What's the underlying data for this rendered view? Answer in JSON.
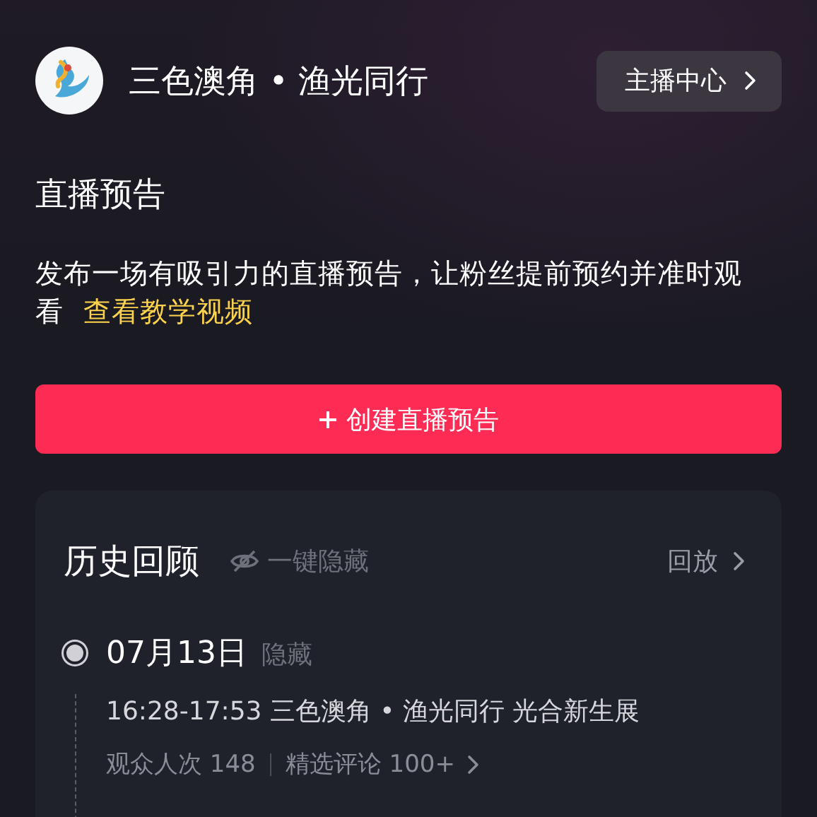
{
  "header": {
    "account_name": "三色澳角 • 渔光同行",
    "center_button": "主播中心"
  },
  "preview": {
    "title": "直播预告",
    "description": "发布一场有吸引力的直播预告，让粉丝提前预约并准时观看",
    "tutorial_link": "查看教学视频",
    "create_button": "创建直播预告"
  },
  "history": {
    "title": "历史回顾",
    "hide_all": "一键隐藏",
    "replay": "回放",
    "entries": [
      {
        "date": "07月13日",
        "hide": "隐藏",
        "session": "16:28-17:53 三色澳角 • 渔光同行 光合新生展",
        "viewers": "观众人次 148",
        "comments": "精选评论 100+"
      }
    ]
  }
}
